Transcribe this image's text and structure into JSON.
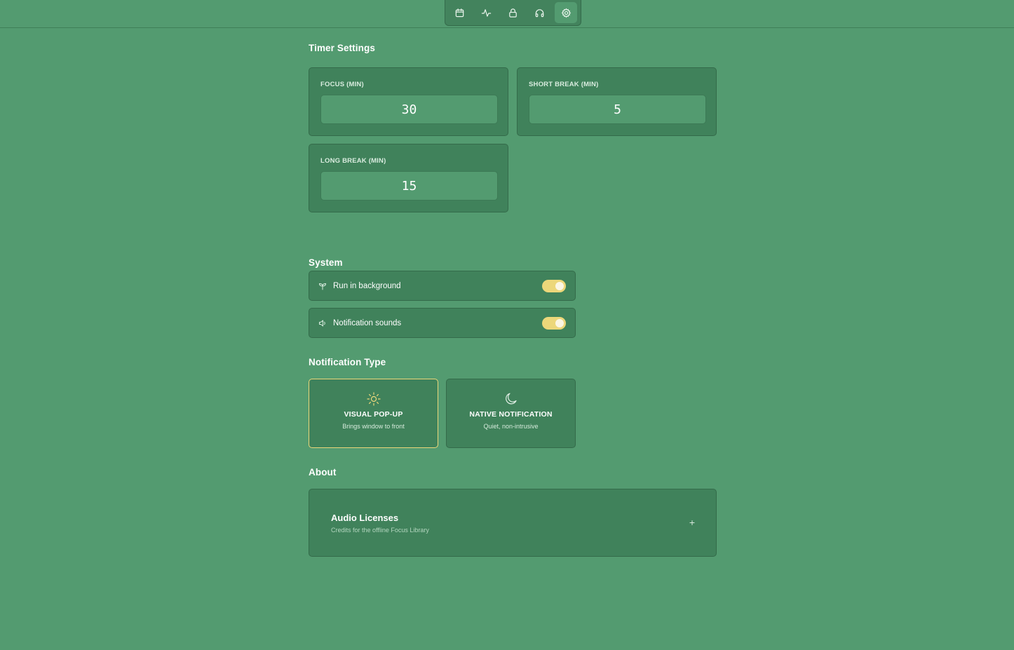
{
  "nav": {
    "items": [
      {
        "icon": "calendar-icon",
        "active": false
      },
      {
        "icon": "activity-icon",
        "active": false
      },
      {
        "icon": "lock-icon",
        "active": false
      },
      {
        "icon": "headphones-icon",
        "active": false
      },
      {
        "icon": "gear-icon",
        "active": true
      }
    ]
  },
  "timer": {
    "title": "Timer Settings",
    "focus": {
      "label": "FOCUS (MIN)",
      "value": "30"
    },
    "short_break": {
      "label": "SHORT BREAK (MIN)",
      "value": "5"
    },
    "long_break": {
      "label": "LONG BREAK (MIN)",
      "value": "15"
    }
  },
  "system": {
    "title": "System",
    "run_background": {
      "label": "Run in background",
      "icon": "sprout-icon",
      "enabled": true
    },
    "notification_sounds": {
      "label": "Notification sounds",
      "icon": "speaker-icon",
      "enabled": true
    }
  },
  "notification_type": {
    "title": "Notification Type",
    "visual": {
      "title": "VISUAL POP-UP",
      "subtitle": "Brings window to front",
      "icon": "sun-icon",
      "selected": true
    },
    "native": {
      "title": "NATIVE NOTIFICATION",
      "subtitle": "Quiet, non-intrusive",
      "icon": "moon-icon",
      "selected": false
    }
  },
  "about": {
    "title": "About",
    "licenses": {
      "title": "Audio Licenses",
      "subtitle": "Credits for the offline Focus Library",
      "expand_glyph": "+"
    }
  },
  "colors": {
    "background": "#539b70",
    "card": "#40825b",
    "accent": "#ecd77a"
  }
}
